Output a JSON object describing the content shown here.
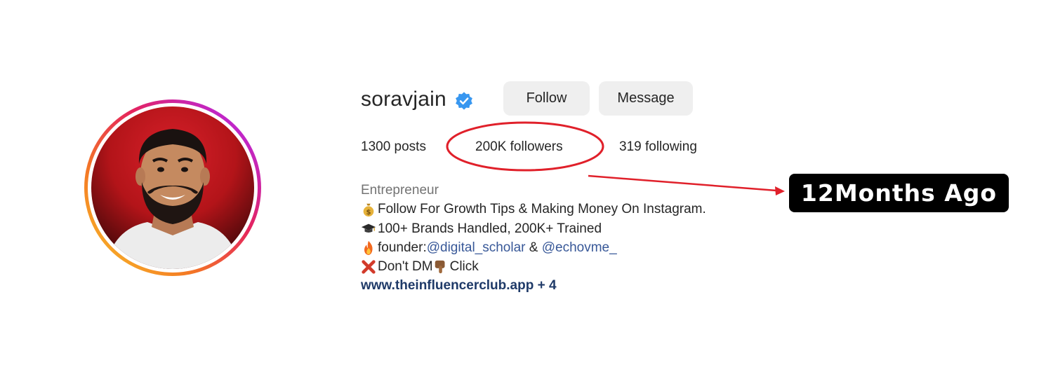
{
  "profile": {
    "username": "soravjain",
    "verified": true,
    "follow_label": "Follow",
    "message_label": "Message"
  },
  "stats": {
    "posts": "1300 posts",
    "followers": "200K followers",
    "following": "319 following"
  },
  "bio": {
    "category": "Entrepreneur",
    "line1": "Follow For Growth Tips & Making Money On Instagram.",
    "line2": "100+ Brands Handled, 200K+ Trained",
    "line3_prefix": "founder: ",
    "mention1": "@digital_scholar",
    "line3_amp": " & ",
    "mention2": "@echovme_",
    "line4_a": "Don't DM",
    "line4_b": "Click",
    "link": "www.theinfluencerclub.app + 4"
  },
  "annotation": {
    "callout": "12Months Ago",
    "highlight_color": "#e0202a"
  },
  "colors": {
    "mention": "#385898",
    "link": "#1f3a68",
    "button_bg": "#efefef",
    "verified": "#3897f0"
  },
  "icons": [
    "verified-badge-icon",
    "money-bag-icon",
    "graduation-cap-icon",
    "fire-icon",
    "cross-mark-icon",
    "pointing-down-icon"
  ]
}
